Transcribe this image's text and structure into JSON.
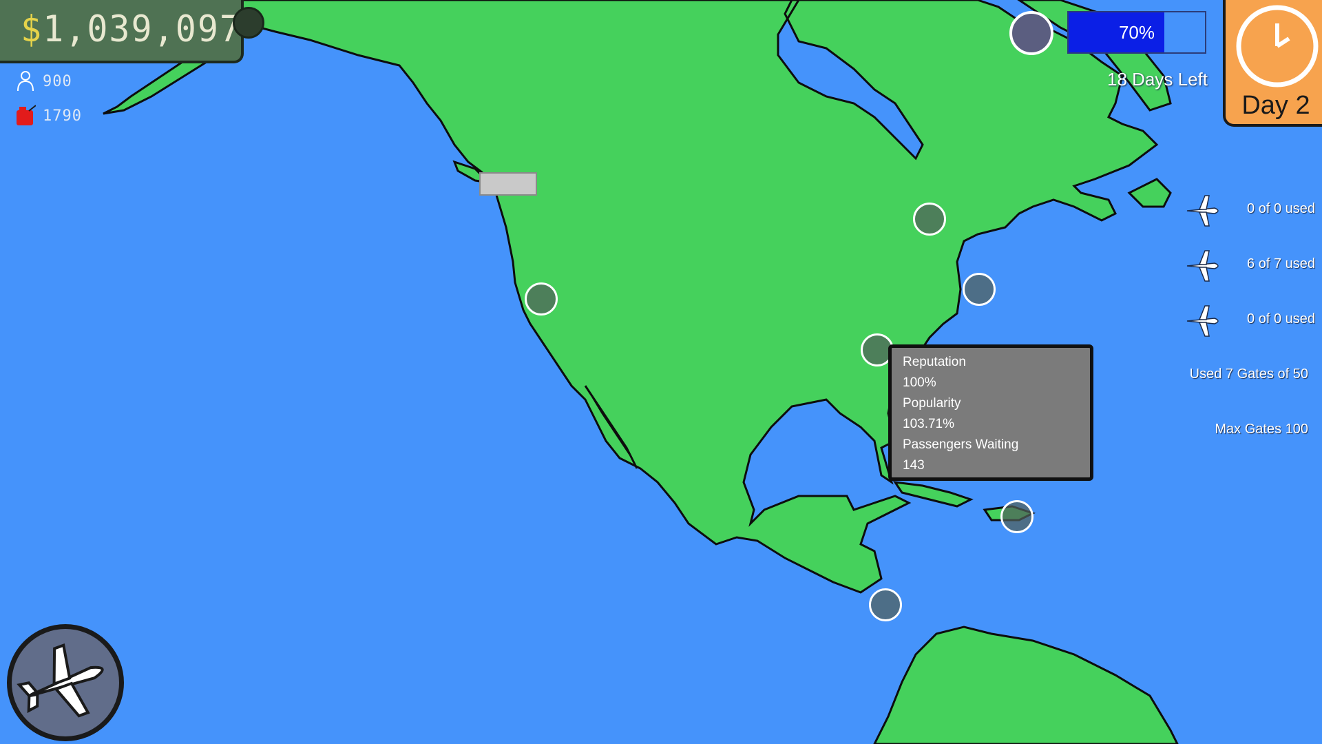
{
  "hud": {
    "money_sign": "$",
    "money_amount": "1,039,097",
    "passengers": "900",
    "fuel": "1790"
  },
  "progress": {
    "percent_label": "70%",
    "fraction": 0.7,
    "days_left": "18 Days Left"
  },
  "day": {
    "label": "Day 2"
  },
  "fleet": [
    {
      "icon": "airplane-icon",
      "text": "0 of 0 used"
    },
    {
      "icon": "airplane-icon",
      "text": "6 of 7 used"
    },
    {
      "icon": "airplane-icon",
      "text": "0 of 0 used"
    }
  ],
  "gates": {
    "used": "Used 7 Gates of 50",
    "max": "Max Gates 100"
  },
  "tooltip": {
    "reputation_label": "Reputation",
    "reputation_value": "100%",
    "popularity_label": "Popularity",
    "popularity_value": "103.71%",
    "waiting_label": "Passengers Waiting",
    "waiting_value": "143"
  },
  "colors": {
    "ocean": "#4593fb",
    "land": "#45d15c",
    "day_panel": "#f7a34e",
    "progress_fill": "#0b1fe6"
  },
  "icons": {
    "passengers": "person-icon",
    "fuel": "fuel-can-icon",
    "open_fleet": "airplane-icon"
  }
}
